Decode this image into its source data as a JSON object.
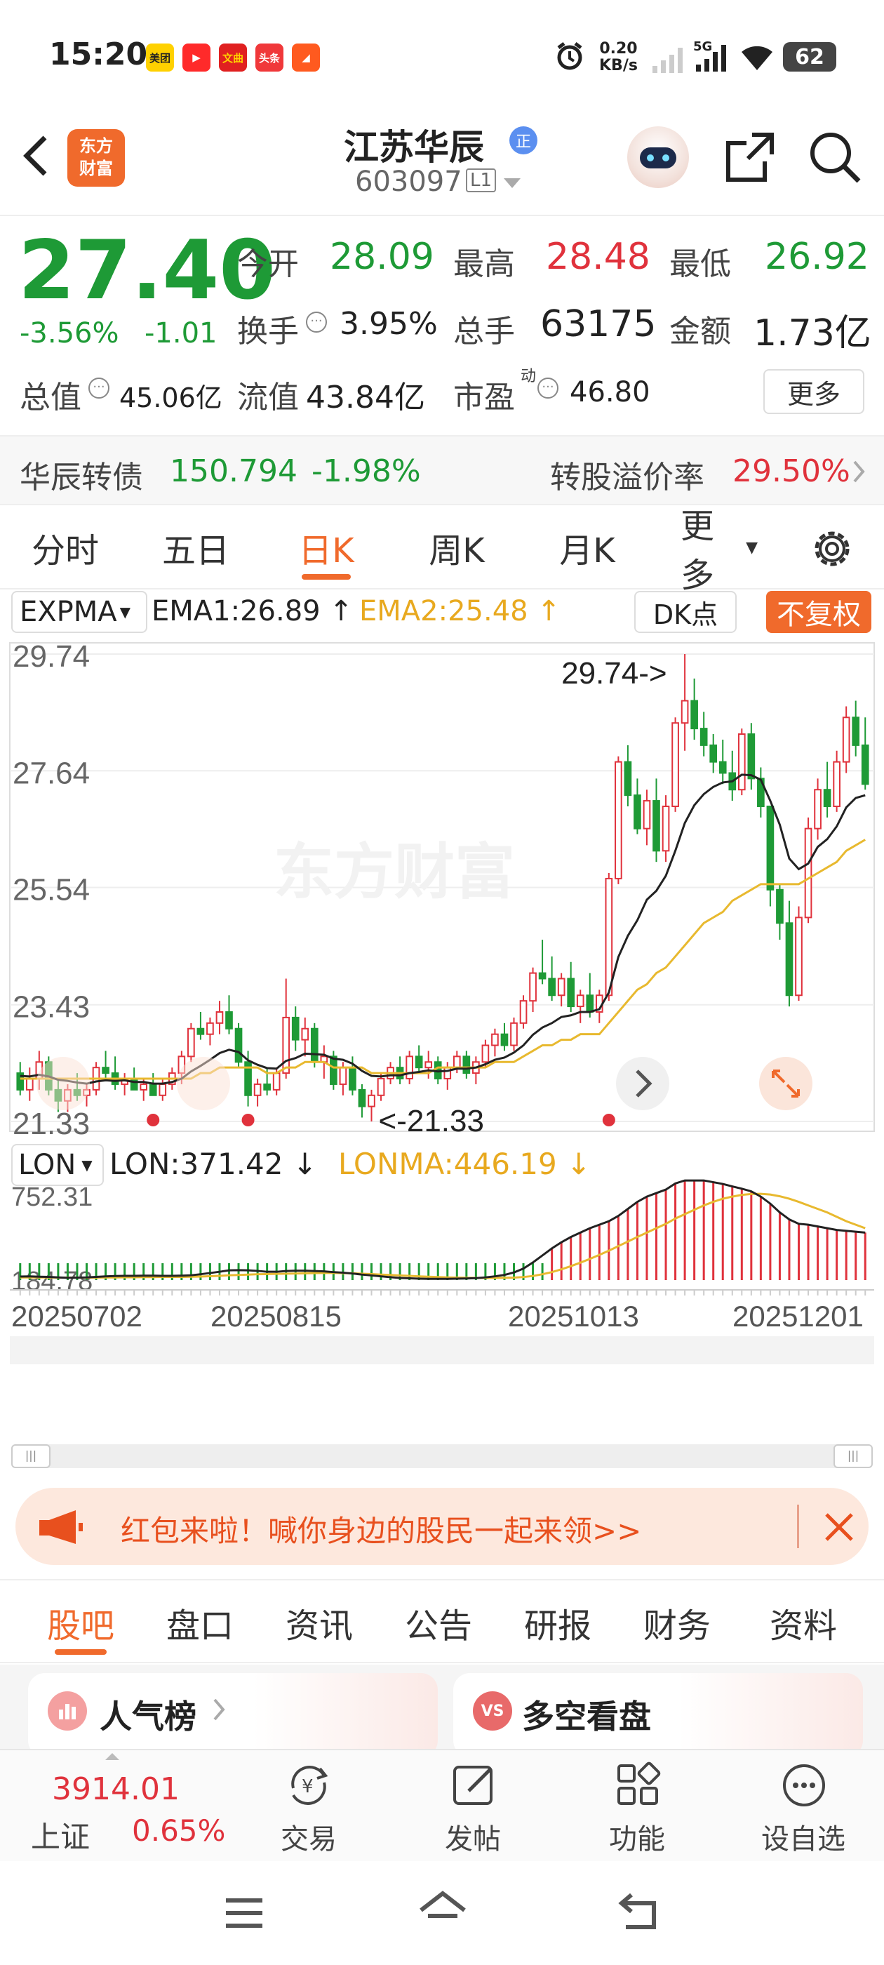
{
  "status_bar": {
    "time": "15:20",
    "app_icons": [
      {
        "label": "美团",
        "color": "#ffd100",
        "text_color": "#222"
      },
      {
        "label": "▶",
        "color": "#ff2a2a",
        "text_color": "#fff"
      },
      {
        "label": "文曲",
        "color": "#e02020",
        "text_color": "#ffd200"
      },
      {
        "label": "头条",
        "color": "#f0383a",
        "text_color": "#fff"
      },
      {
        "label": "◢",
        "color": "#ff5a1f",
        "text_color": "#fff"
      }
    ],
    "net_speed": "0.20",
    "net_unit": "KB/s",
    "network": "5G",
    "battery": "62"
  },
  "header": {
    "logo_line1": "东方",
    "logo_line2": "财富",
    "stock_name": "江苏华辰",
    "badge": "正",
    "stock_code": "603097",
    "level": "L1"
  },
  "quote": {
    "price": "27.40",
    "change_pct": "-3.56%",
    "change": "-1.01",
    "open_label": "今开",
    "open": "28.09",
    "high_label": "最高",
    "high": "28.48",
    "low_label": "最低",
    "low": "26.92",
    "turnover_label": "换手",
    "turnover": "3.95%",
    "volume_label": "总手",
    "volume": "63175",
    "amount_label": "金额",
    "amount": "1.73亿",
    "mcap_label": "总值",
    "mcap": "45.06亿",
    "float_label": "流值",
    "float": "43.84亿",
    "pe_label": "市盈",
    "pe_sup": "动",
    "pe": "46.80",
    "more": "更多"
  },
  "convertible": {
    "name": "华辰转债",
    "price": "150.794",
    "change": "-1.98%",
    "premium_label": "转股溢价率",
    "premium": "29.50%"
  },
  "period_tabs": {
    "items": [
      "分时",
      "五日",
      "日K",
      "周K",
      "月K",
      "更多"
    ],
    "active": 2
  },
  "main_indicator": {
    "name": "EXPMA",
    "ema1": "EMA1:26.89",
    "ema1_arrow": "↑",
    "ema2": "EMA2:25.48",
    "ema2_arrow": "↑",
    "dk": "DK点",
    "adjust": "不复权",
    "watermark": "东方财富"
  },
  "sub_indicator": {
    "name": "LON",
    "lon": "LON:371.42",
    "lon_arrow": "↓",
    "lonma": "LONMA:446.19",
    "lonma_arrow": "↓"
  },
  "colors": {
    "up": "#e0323c",
    "down": "#1e9a36",
    "ema1": "#222222",
    "ema2": "#e8b92f",
    "accent": "#f06a2c"
  },
  "chart_data": [
    {
      "type": "candlestick",
      "y_ticks": [
        "29.74",
        "27.64",
        "25.54",
        "23.43",
        "21.33"
      ],
      "ylim": [
        21.33,
        29.74
      ],
      "max_label": "29.74->",
      "min_label": "<-21.33",
      "max_value": 29.74,
      "min_value": 21.33,
      "ema1_last": 26.89,
      "ema2_last": 25.48,
      "x_labels": [
        "20250702",
        "20250815",
        "20251013",
        "20251201"
      ],
      "candles": [
        [
          22.2,
          22.4,
          21.8,
          21.9
        ],
        [
          21.9,
          22.3,
          21.7,
          22.1
        ],
        [
          22.1,
          22.6,
          21.9,
          22.4
        ],
        [
          22.4,
          22.5,
          21.8,
          21.9
        ],
        [
          21.9,
          22.1,
          21.5,
          21.7
        ],
        [
          21.7,
          22.0,
          21.5,
          21.9
        ],
        [
          21.9,
          22.2,
          21.7,
          21.8
        ],
        [
          21.8,
          22.0,
          21.6,
          21.9
        ],
        [
          21.9,
          22.4,
          21.8,
          22.3
        ],
        [
          22.3,
          22.6,
          22.1,
          22.2
        ],
        [
          22.2,
          22.5,
          21.9,
          22.0
        ],
        [
          22.0,
          22.2,
          21.8,
          22.1
        ],
        [
          22.1,
          22.3,
          21.9,
          21.9
        ],
        [
          21.9,
          22.1,
          21.7,
          22.0
        ],
        [
          22.0,
          22.2,
          21.8,
          21.8
        ],
        [
          21.8,
          22.1,
          21.7,
          22.0
        ],
        [
          22.0,
          22.3,
          21.9,
          22.2
        ],
        [
          22.2,
          22.6,
          22.0,
          22.5
        ],
        [
          22.5,
          23.1,
          22.4,
          23.0
        ],
        [
          23.0,
          23.3,
          22.8,
          22.9
        ],
        [
          22.9,
          23.2,
          22.7,
          23.1
        ],
        [
          23.1,
          23.5,
          22.9,
          23.3
        ],
        [
          23.3,
          23.6,
          22.9,
          23.0
        ],
        [
          23.0,
          23.1,
          22.3,
          22.4
        ],
        [
          22.4,
          22.6,
          21.6,
          21.8
        ],
        [
          21.8,
          22.1,
          21.6,
          22.0
        ],
        [
          22.0,
          22.3,
          21.8,
          21.9
        ],
        [
          21.9,
          22.3,
          21.8,
          22.2
        ],
        [
          22.2,
          23.9,
          22.1,
          23.2
        ],
        [
          23.2,
          23.4,
          22.6,
          22.8
        ],
        [
          22.8,
          23.2,
          22.5,
          23.0
        ],
        [
          23.0,
          23.1,
          22.3,
          22.4
        ],
        [
          22.4,
          22.7,
          22.1,
          22.5
        ],
        [
          22.5,
          22.6,
          21.9,
          22.0
        ],
        [
          22.0,
          22.4,
          21.8,
          22.3
        ],
        [
          22.3,
          22.5,
          21.8,
          21.9
        ],
        [
          21.9,
          22.0,
          21.4,
          21.6
        ],
        [
          21.6,
          21.9,
          21.33,
          21.8
        ],
        [
          21.8,
          22.2,
          21.7,
          22.1
        ],
        [
          22.1,
          22.4,
          22.0,
          22.3
        ],
        [
          22.3,
          22.5,
          22.0,
          22.1
        ],
        [
          22.1,
          22.6,
          22.0,
          22.5
        ],
        [
          22.5,
          22.7,
          22.2,
          22.3
        ],
        [
          22.3,
          22.6,
          22.1,
          22.4
        ],
        [
          22.4,
          22.5,
          22.0,
          22.1
        ],
        [
          22.1,
          22.4,
          21.9,
          22.3
        ],
        [
          22.3,
          22.6,
          22.2,
          22.5
        ],
        [
          22.5,
          22.6,
          22.1,
          22.2
        ],
        [
          22.2,
          22.5,
          22.0,
          22.4
        ],
        [
          22.4,
          22.8,
          22.3,
          22.7
        ],
        [
          22.7,
          23.0,
          22.5,
          22.9
        ],
        [
          22.9,
          23.1,
          22.6,
          22.7
        ],
        [
          22.7,
          23.2,
          22.6,
          23.1
        ],
        [
          23.1,
          23.6,
          23.0,
          23.5
        ],
        [
          23.5,
          24.1,
          23.3,
          24.0
        ],
        [
          24.0,
          24.6,
          23.8,
          23.9
        ],
        [
          23.9,
          24.3,
          23.5,
          23.6
        ],
        [
          23.6,
          24.0,
          23.4,
          23.9
        ],
        [
          23.9,
          24.2,
          23.3,
          23.4
        ],
        [
          23.4,
          23.7,
          23.1,
          23.6
        ],
        [
          23.6,
          24.0,
          23.2,
          23.3
        ],
        [
          23.3,
          23.7,
          23.1,
          23.6
        ],
        [
          23.6,
          25.8,
          23.5,
          25.7
        ],
        [
          25.7,
          27.9,
          25.6,
          27.8
        ],
        [
          27.8,
          28.1,
          27.0,
          27.2
        ],
        [
          27.2,
          27.5,
          26.5,
          26.6
        ],
        [
          26.6,
          27.3,
          26.3,
          27.1
        ],
        [
          27.1,
          27.5,
          26.0,
          26.2
        ],
        [
          26.2,
          27.2,
          26.0,
          27.0
        ],
        [
          27.0,
          28.6,
          26.9,
          28.5
        ],
        [
          28.5,
          29.74,
          28.0,
          28.9
        ],
        [
          28.9,
          29.3,
          28.2,
          28.4
        ],
        [
          28.4,
          28.7,
          27.9,
          28.1
        ],
        [
          28.1,
          28.3,
          27.6,
          27.8
        ],
        [
          27.8,
          28.2,
          27.4,
          27.6
        ],
        [
          27.6,
          28.0,
          27.1,
          27.3
        ],
        [
          27.3,
          28.4,
          27.2,
          28.3
        ],
        [
          28.3,
          28.5,
          27.3,
          27.5
        ],
        [
          27.5,
          27.7,
          26.8,
          27.0
        ],
        [
          27.0,
          26.9,
          25.2,
          25.5
        ],
        [
          25.5,
          25.6,
          24.6,
          24.9
        ],
        [
          24.9,
          25.3,
          23.4,
          23.6
        ],
        [
          23.6,
          25.2,
          23.5,
          25.0
        ],
        [
          25.0,
          26.8,
          24.9,
          26.6
        ],
        [
          26.6,
          27.5,
          26.4,
          27.3
        ],
        [
          27.3,
          27.8,
          26.8,
          27.0
        ],
        [
          27.0,
          28.0,
          26.9,
          27.8
        ],
        [
          27.8,
          28.8,
          27.6,
          28.6
        ],
        [
          28.6,
          28.9,
          27.9,
          28.1
        ],
        [
          28.1,
          28.6,
          27.3,
          27.4
        ]
      ],
      "ema1": [
        22.15,
        22.14,
        22.17,
        22.14,
        22.08,
        22.06,
        22.03,
        22.01,
        22.05,
        22.07,
        22.06,
        22.07,
        22.04,
        22.04,
        22.01,
        22.01,
        22.04,
        22.1,
        22.23,
        22.33,
        22.44,
        22.56,
        22.62,
        22.58,
        22.43,
        22.35,
        22.29,
        22.28,
        22.42,
        22.47,
        22.55,
        22.54,
        22.53,
        22.46,
        22.44,
        22.37,
        22.24,
        22.15,
        22.14,
        22.16,
        22.16,
        22.2,
        22.22,
        22.25,
        22.23,
        22.24,
        22.28,
        22.28,
        22.3,
        22.36,
        22.44,
        22.48,
        22.57,
        22.7,
        22.89,
        23.02,
        23.1,
        23.21,
        23.24,
        23.3,
        23.3,
        23.35,
        23.65,
        24.29,
        24.67,
        24.95,
        25.32,
        25.48,
        25.75,
        26.2,
        26.7,
        27.02,
        27.22,
        27.35,
        27.43,
        27.45,
        27.57,
        27.56,
        27.48,
        27.1,
        26.67,
        26.06,
        25.87,
        25.97,
        26.27,
        26.41,
        26.64,
        26.98,
        27.15,
        27.2
      ],
      "ema2": [
        22.1,
        22.1,
        22.1,
        22.1,
        22.1,
        22.1,
        22.1,
        22.1,
        22.1,
        22.1,
        22.1,
        22.1,
        22.1,
        22.1,
        22.1,
        22.1,
        22.1,
        22.1,
        22.1,
        22.2,
        22.2,
        22.3,
        22.3,
        22.3,
        22.3,
        22.3,
        22.2,
        22.2,
        22.3,
        22.3,
        22.4,
        22.4,
        22.4,
        22.3,
        22.3,
        22.3,
        22.3,
        22.2,
        22.2,
        22.2,
        22.2,
        22.2,
        22.2,
        22.2,
        22.3,
        22.3,
        22.3,
        22.3,
        22.3,
        22.3,
        22.4,
        22.4,
        22.4,
        22.5,
        22.6,
        22.7,
        22.7,
        22.8,
        22.8,
        22.9,
        22.9,
        22.9,
        23.1,
        23.3,
        23.5,
        23.7,
        23.8,
        24.0,
        24.1,
        24.3,
        24.5,
        24.7,
        24.9,
        25.0,
        25.1,
        25.3,
        25.4,
        25.5,
        25.6,
        25.6,
        25.6,
        25.6,
        25.6,
        25.7,
        25.8,
        25.9,
        26.0,
        26.2,
        26.3,
        26.4
      ]
    },
    {
      "type": "bar",
      "title": "LON",
      "y_ticks": [
        "752.31",
        "184.78"
      ],
      "ylim": [
        184.78,
        752.31
      ],
      "lon_last": 371.42,
      "lonma_last": 446.19,
      "lon": [
        205,
        206,
        204,
        203,
        200,
        198,
        199,
        200,
        203,
        206,
        208,
        209,
        209,
        210,
        210,
        209,
        209,
        210,
        212,
        218,
        225,
        232,
        240,
        241,
        240,
        237,
        232,
        232,
        236,
        238,
        238,
        236,
        234,
        230,
        227,
        222,
        216,
        211,
        206,
        201,
        197,
        195,
        193,
        192,
        192,
        192,
        193,
        194,
        196,
        200,
        206,
        214,
        228,
        250,
        285,
        325,
        365,
        400,
        430,
        455,
        480,
        500,
        520,
        550,
        590,
        630,
        660,
        680,
        700,
        735,
        752,
        752,
        752,
        742,
        732,
        718,
        705,
        690,
        660,
        620,
        570,
        530,
        505,
        500,
        490,
        480,
        470,
        465,
        460,
        455
      ],
      "lonma": [
        200,
        200,
        200,
        200,
        199,
        199,
        199,
        199,
        199,
        200,
        200,
        201,
        201,
        202,
        202,
        203,
        203,
        203,
        204,
        205,
        207,
        209,
        212,
        214,
        216,
        218,
        219,
        220,
        221,
        222,
        223,
        224,
        225,
        225,
        224,
        223,
        221,
        219,
        216,
        214,
        211,
        209,
        206,
        204,
        202,
        200,
        199,
        198,
        197,
        197,
        197,
        198,
        199,
        202,
        208,
        218,
        230,
        246,
        264,
        284,
        305,
        328,
        352,
        378,
        404,
        430,
        455,
        480,
        505,
        535,
        560,
        585,
        610,
        630,
        648,
        660,
        670,
        675,
        676,
        672,
        662,
        648,
        630,
        610,
        590,
        570,
        545,
        520,
        500,
        480
      ]
    }
  ],
  "promo": {
    "text": "红包来啦！喊你身边的股民一起来领>>"
  },
  "content_tabs": {
    "items": [
      "股吧",
      "盘口",
      "资讯",
      "公告",
      "研报",
      "财务",
      "资料"
    ],
    "active": 0
  },
  "cards": {
    "left": "人气榜",
    "right_icon": "VS",
    "right": "多空看盘"
  },
  "bottom_nav": {
    "index_value": "3914.01",
    "index_name": "上证",
    "index_change": "0.65%",
    "items": [
      "交易",
      "发帖",
      "功能",
      "设自选"
    ]
  }
}
